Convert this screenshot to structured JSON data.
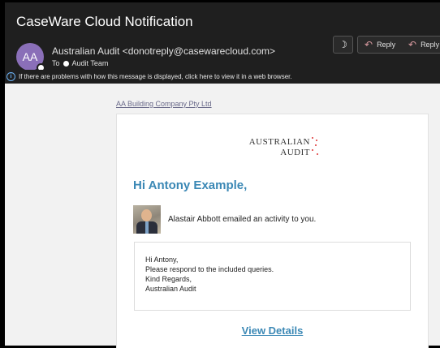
{
  "window": {
    "subject": "CaseWare Cloud Notification"
  },
  "sender": {
    "initials": "AA",
    "from": "Australian Audit <donotreply@casewarecloud.com>",
    "to_label": "To",
    "to_recipient": "Audit Team"
  },
  "toolbar": {
    "moon_icon": "moon-icon",
    "reply_label": "Reply",
    "reply_all_label": "Reply"
  },
  "infobar": {
    "text": "If there are problems with how this message is displayed, click here to view it in a web browser."
  },
  "email": {
    "company_link": "AA Building Company Pty Ltd",
    "logo_line1": "AUSTRALIAN",
    "logo_line2": "AUDIT",
    "greeting": "Hi Antony Example,",
    "activity": "Alastair Abbott emailed an activity to you.",
    "message_lines": [
      "Hi Antony,",
      "Please respond to the included queries.",
      "Kind Regards,",
      "Australian Audit"
    ],
    "view_details": "View Details"
  },
  "colors": {
    "accent": "#3b88b5",
    "avatar": "#8a6fb8",
    "header_bg": "#1f1f1f"
  }
}
